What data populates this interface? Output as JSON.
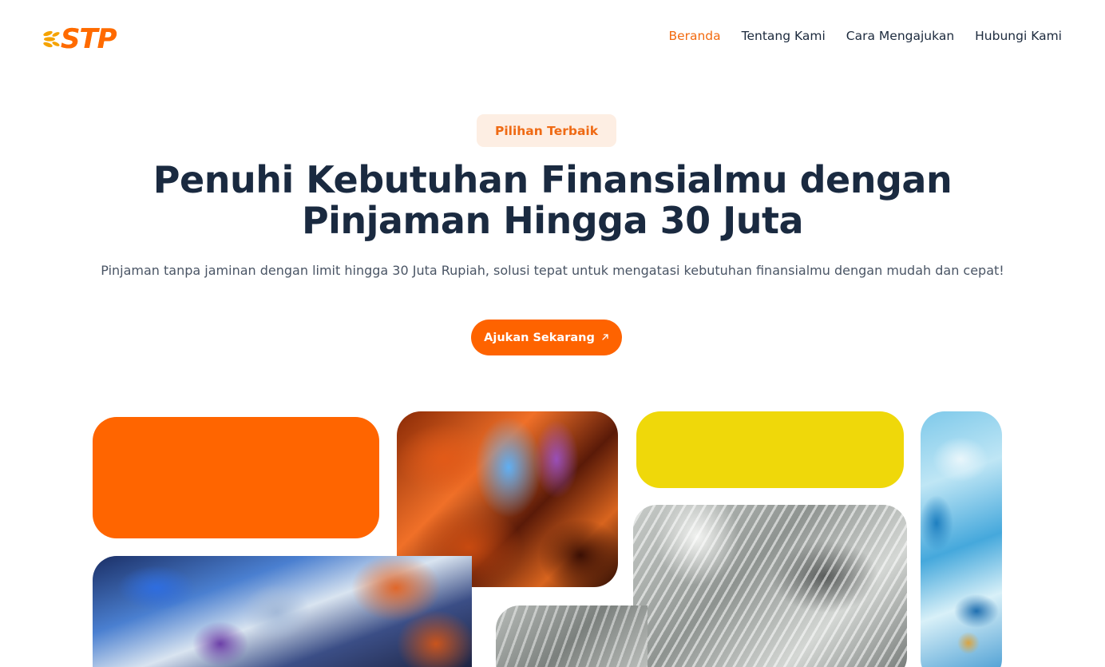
{
  "brand": {
    "logo_text": "STP"
  },
  "nav": {
    "items": [
      {
        "label": "Beranda",
        "active": true
      },
      {
        "label": "Tentang Kami",
        "active": false
      },
      {
        "label": "Cara Mengajukan",
        "active": false
      },
      {
        "label": "Hubungi Kami",
        "active": false
      }
    ]
  },
  "hero": {
    "badge": "Pilihan Terbaik",
    "headline_line1": "Penuhi Kebutuhan Finansialmu dengan",
    "headline_line2": "Pinjaman Hingga 30 Juta",
    "subtitle": "Pinjaman tanpa jaminan dengan limit hingga 30 Juta Rupiah, solusi tepat untuk mengatasi kebutuhan finansialmu dengan mudah dan cepat!",
    "cta_label": "Ajukan Sekarang",
    "cta_icon": "arrow-up-right-icon"
  },
  "colors": {
    "accent": "#fe6300",
    "heading": "#1a2a40",
    "badge_bg": "#fdeee3",
    "tile_orange": "#ff6500",
    "tile_yellow": "#efd80a"
  }
}
